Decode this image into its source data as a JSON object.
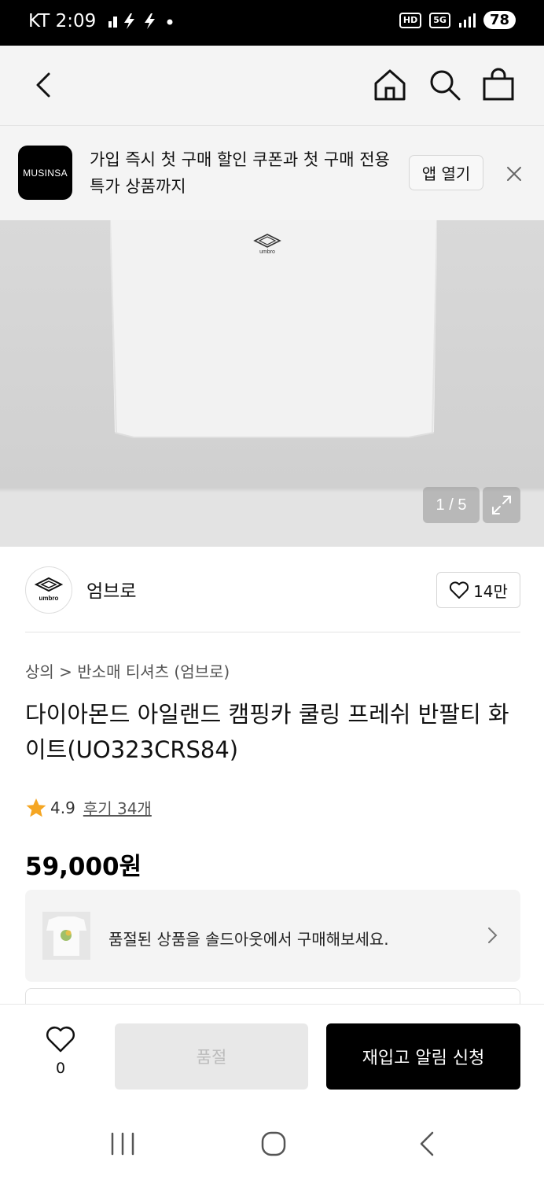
{
  "status_bar": {
    "carrier_time": "KT 2:09",
    "hd_label": "HD",
    "network_label": "5G",
    "battery": "78"
  },
  "banner": {
    "logo_text": "MUSINSA",
    "text": "가입 즉시 첫 구매 할인 쿠폰과 첫 구매 전용 특가 상품까지",
    "open_label": "앱 열기"
  },
  "product_image": {
    "counter": "1 / 5",
    "logo_text": "umbro"
  },
  "brand": {
    "logo_text": "umbro",
    "name": "엄브로",
    "likes": "14만"
  },
  "breadcrumb": "상의 > 반소매 티셔츠 (엄브로)",
  "product": {
    "title": "다이아몬드 아일랜드 캠핑카 쿨링 프레쉬 반팔티 화이트(UO323CRS84)",
    "rating": "4.9",
    "reviews": "후기 34개",
    "price": "59,000원"
  },
  "soldout_notice": "품절된 상품을 솔드아웃에서 구매해보세요.",
  "bottom_bar": {
    "wish_count": "0",
    "soldout_label": "품절",
    "restock_label": "재입고 알림 신청"
  },
  "colors": {
    "accent_star": "#F5A623",
    "primary_button": "#000000",
    "disabled_button": "#E8E8E8"
  }
}
